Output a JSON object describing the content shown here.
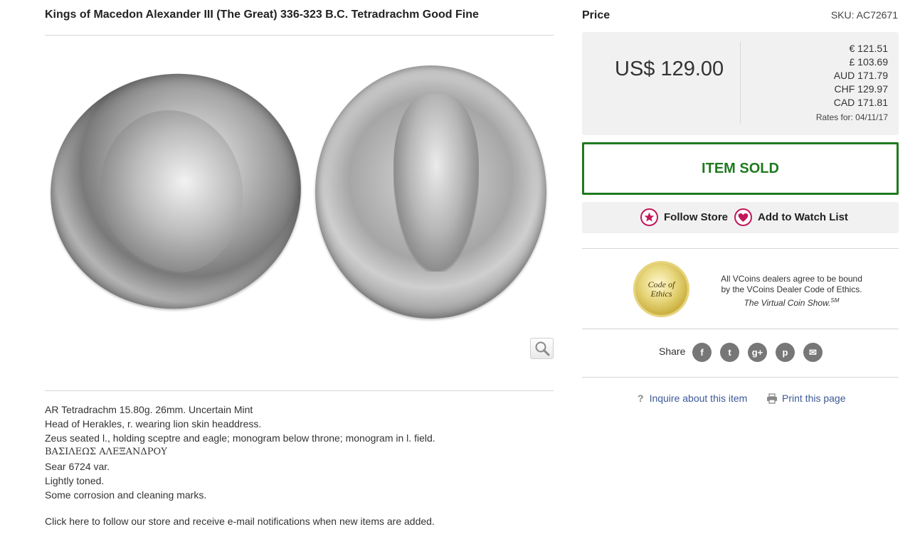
{
  "listing": {
    "title": "Kings of Macedon Alexander III (The Great) 336-323 B.C. Tetradrachm Good Fine"
  },
  "icons": {
    "zoom": "magnifier-icon",
    "follow": "star-icon",
    "watch": "heart-icon",
    "inquire": "question-icon",
    "print": "printer-icon"
  },
  "description": {
    "lines": [
      "AR Tetradrachm 15.80g. 26mm. Uncertain Mint",
      "Head of Herakles, r. wearing lion skin headdress.",
      "Zeus seated l., holding sceptre and eagle; monogram below throne; monogram in l. field.",
      "ΒΑΣΙΛΕΩΣ ΑΛΕΞΑΝΔΡΟΥ",
      "Sear 6724 var.",
      "Lightly toned.",
      "Some corrosion and cleaning marks."
    ],
    "follow_text": "Click here to follow our store and receive e-mail notifications when new items are added."
  },
  "pricing": {
    "label": "Price",
    "sku": "SKU: AC72671",
    "usd": "US$ 129.00",
    "conversions": [
      "€ 121.51",
      "£ 103.69",
      "AUD 171.79",
      "CHF 129.97",
      "CAD 171.81"
    ],
    "rates_note": "Rates for: 04/11/17"
  },
  "status": {
    "sold_label": "ITEM SOLD",
    "sold_color": "#1f7a1f"
  },
  "actions": {
    "follow_label": "Follow Store",
    "watch_label": "Add to Watch List",
    "accent_color": "#c2185b"
  },
  "ethics": {
    "seal_line1": "Code of",
    "seal_line2": "Ethics",
    "text_line1": "All VCoins dealers agree to be bound",
    "text_line2": "by the VCoins Dealer Code of Ethics.",
    "text_line3": "The Virtual Coin Show.",
    "text_sup": "SM"
  },
  "share": {
    "label": "Share",
    "networks": [
      {
        "name": "facebook-icon",
        "glyph": "f"
      },
      {
        "name": "twitter-icon",
        "glyph": "t"
      },
      {
        "name": "google-plus-icon",
        "glyph": "g+"
      },
      {
        "name": "pinterest-icon",
        "glyph": "p"
      },
      {
        "name": "email-icon",
        "glyph": "✉"
      }
    ]
  },
  "links": {
    "inquire": "Inquire about this item",
    "print": "Print this page"
  }
}
